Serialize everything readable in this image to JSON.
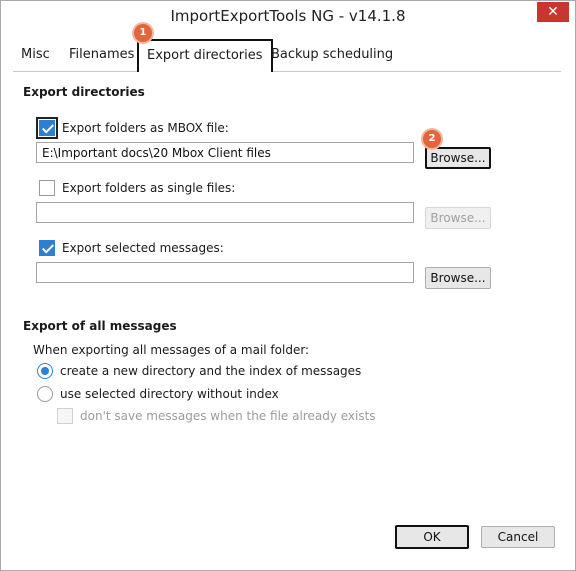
{
  "window": {
    "title": "ImportExportTools NG - v14.1.8",
    "close_glyph": "✕"
  },
  "tabs": [
    {
      "label": "Misc",
      "active": false
    },
    {
      "label": "Filenames",
      "active": false
    },
    {
      "label": "Export directories",
      "active": true
    },
    {
      "label": "Backup scheduling",
      "active": false
    }
  ],
  "badges": {
    "tab_badge": "1",
    "browse_badge": "2",
    "color": "#e2653e"
  },
  "export_directories": {
    "section_title": "Export directories",
    "mbox": {
      "label": "Export folders as MBOX file:",
      "checked": true,
      "path": "E:\\Important docs\\20 Mbox Client files",
      "browse_label": "Browse..."
    },
    "single": {
      "label": "Export folders as single files:",
      "checked": false,
      "path": "",
      "browse_label": "Browse..."
    },
    "selected": {
      "label": "Export selected messages:",
      "checked": true,
      "path": "",
      "browse_label": "Browse..."
    }
  },
  "export_all": {
    "section_title": "Export of all messages",
    "intro": "When exporting all messages of a mail folder:",
    "option_new_dir": "create a new directory and the index of messages",
    "option_selected_dir": "use selected directory without index",
    "dont_save_label": "don't save messages when the file already exists"
  },
  "footer": {
    "ok_label": "OK",
    "cancel_label": "Cancel"
  },
  "colors": {
    "accent": "#2d7fd3",
    "close": "#c7372f"
  }
}
